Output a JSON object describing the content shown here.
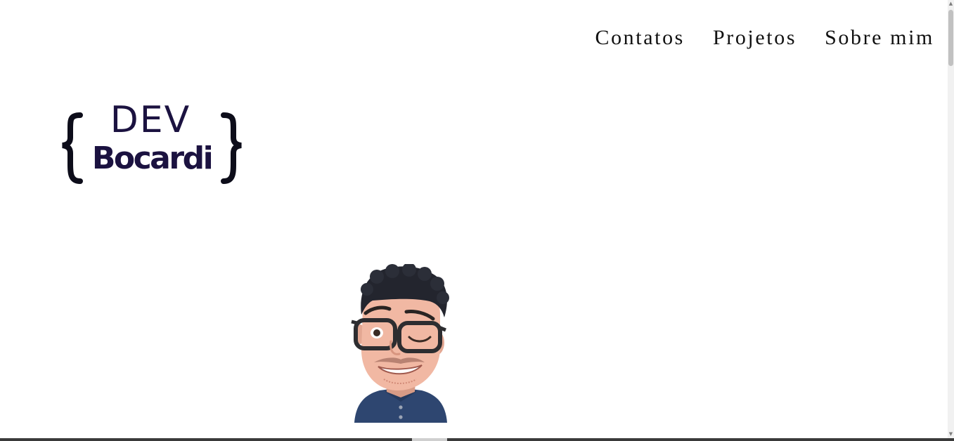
{
  "nav": {
    "items": [
      {
        "label": "Contatos"
      },
      {
        "label": "Projetos"
      },
      {
        "label": "Sobre mim"
      }
    ]
  },
  "logo": {
    "line1": "DEV",
    "line2": "Bocardi",
    "color": "#1b1240"
  },
  "avatar": {
    "icon": "memoji-avatar"
  }
}
